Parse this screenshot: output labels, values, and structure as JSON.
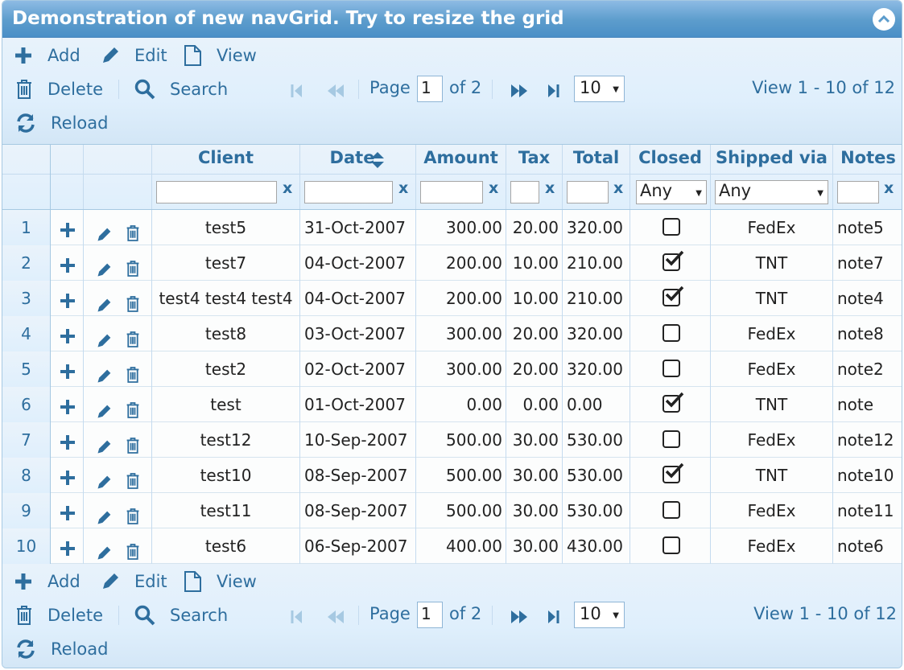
{
  "caption": "Demonstration of new navGrid. Try to resize the grid",
  "toolbar": {
    "add": "Add",
    "edit": "Edit",
    "view": "View",
    "delete": "Delete",
    "search": "Search",
    "reload": "Reload"
  },
  "pager": {
    "page_label": "Page",
    "page_value": "1",
    "of_label": "of 2",
    "rows_per_page": "10",
    "info": "View 1 - 10 of 12"
  },
  "columns": [
    "Client",
    "Date",
    "Amount",
    "Tax",
    "Total",
    "Closed",
    "Shipped via",
    "Notes"
  ],
  "filters": {
    "closed": "Any",
    "shipped": "Any",
    "clear": "x"
  },
  "rows": [
    {
      "n": "1",
      "client": "test5",
      "date": "31-Oct-2007",
      "amount": "300.00",
      "tax": "20.00",
      "total": "320.00",
      "closed": false,
      "ship": "FedEx",
      "note": "note5"
    },
    {
      "n": "2",
      "client": "test7",
      "date": "04-Oct-2007",
      "amount": "200.00",
      "tax": "10.00",
      "total": "210.00",
      "closed": true,
      "ship": "TNT",
      "note": "note7"
    },
    {
      "n": "3",
      "client": "test4 test4 test4",
      "date": "04-Oct-2007",
      "amount": "200.00",
      "tax": "10.00",
      "total": "210.00",
      "closed": true,
      "ship": "TNT",
      "note": "note4"
    },
    {
      "n": "4",
      "client": "test8",
      "date": "03-Oct-2007",
      "amount": "300.00",
      "tax": "20.00",
      "total": "320.00",
      "closed": false,
      "ship": "FedEx",
      "note": "note8"
    },
    {
      "n": "5",
      "client": "test2",
      "date": "02-Oct-2007",
      "amount": "300.00",
      "tax": "20.00",
      "total": "320.00",
      "closed": false,
      "ship": "FedEx",
      "note": "note2"
    },
    {
      "n": "6",
      "client": "test",
      "date": "01-Oct-2007",
      "amount": "0.00",
      "tax": "0.00",
      "total": "0.00",
      "closed": true,
      "ship": "TNT",
      "note": "note"
    },
    {
      "n": "7",
      "client": "test12",
      "date": "10-Sep-2007",
      "amount": "500.00",
      "tax": "30.00",
      "total": "530.00",
      "closed": false,
      "ship": "FedEx",
      "note": "note12"
    },
    {
      "n": "8",
      "client": "test10",
      "date": "08-Sep-2007",
      "amount": "500.00",
      "tax": "30.00",
      "total": "530.00",
      "closed": true,
      "ship": "TNT",
      "note": "note10"
    },
    {
      "n": "9",
      "client": "test11",
      "date": "08-Sep-2007",
      "amount": "500.00",
      "tax": "30.00",
      "total": "530.00",
      "closed": false,
      "ship": "FedEx",
      "note": "note11"
    },
    {
      "n": "10",
      "client": "test6",
      "date": "06-Sep-2007",
      "amount": "400.00",
      "tax": "30.00",
      "total": "430.00",
      "closed": false,
      "ship": "FedEx",
      "note": "note6"
    }
  ],
  "colors": {
    "accent": "#2e6e9e",
    "header_bg": "#5c9ccc",
    "border": "#a6c9e2"
  }
}
